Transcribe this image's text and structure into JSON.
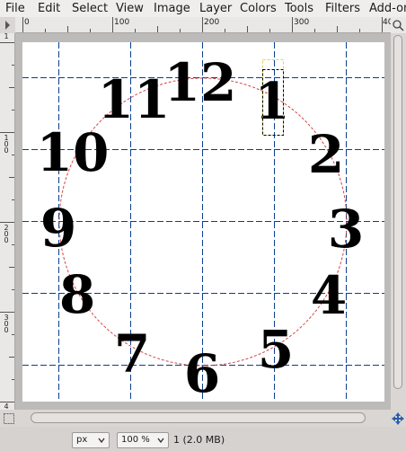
{
  "menubar": {
    "items": [
      "File",
      "Edit",
      "Select",
      "View",
      "Image",
      "Layer",
      "Colors",
      "Tools",
      "Filters",
      "Add-ons"
    ]
  },
  "rulers": {
    "horizontal_labels": [
      "0",
      "100",
      "200",
      "300",
      "40"
    ],
    "vertical_labels": [
      "1",
      "100",
      "200",
      "300",
      "4"
    ]
  },
  "canvas": {
    "clock_numerals": [
      "12",
      "1",
      "2",
      "3",
      "4",
      "5",
      "6",
      "7",
      "8",
      "9",
      "10",
      "11"
    ],
    "guide_color": "#0a3f8f",
    "circle_path_color": "#d64545",
    "selection_color": "#e6d43a"
  },
  "statusbar": {
    "unit_value": "px",
    "zoom_value": "100 %",
    "layer_info": "1 (2.0 MB)"
  },
  "icons": {
    "corner": "pointer-icon",
    "zoom_toggle": "zoom-toggle-icon",
    "quick_mask": "quick-mask-icon",
    "navigate": "navigate-icon",
    "dropdown": "chevron-down-icon"
  }
}
